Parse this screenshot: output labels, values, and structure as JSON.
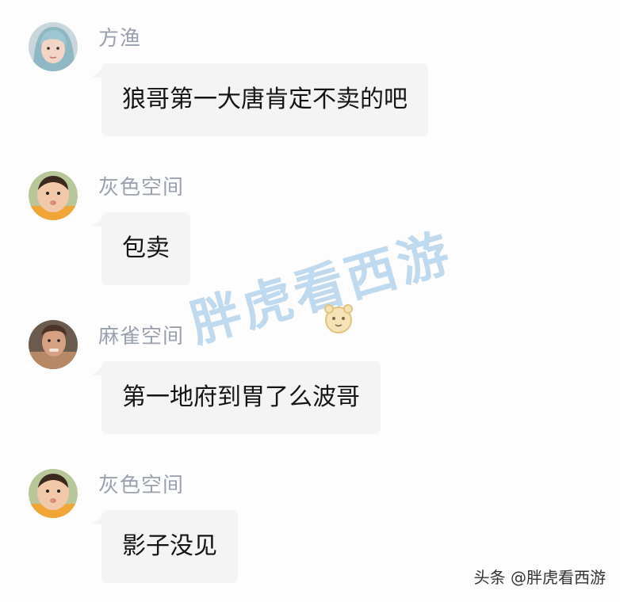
{
  "messages": [
    {
      "author": "方渔",
      "text": "狼哥第一大唐肯定不卖的吧",
      "avatar": "girl-avatar"
    },
    {
      "author": "灰色空间",
      "text": "包卖",
      "avatar": "baby-avatar"
    },
    {
      "author": "麻雀空间",
      "text": "第一地府到胃了么波哥",
      "avatar": "man-avatar"
    },
    {
      "author": "灰色空间",
      "text": "影子没见",
      "avatar": "baby-avatar"
    }
  ],
  "watermark": {
    "text": "胖虎看西游",
    "color": "#8cbee1"
  },
  "footer": {
    "text": "头条 @胖虎看西游"
  },
  "colors": {
    "bubble": "#f4f4f5",
    "name": "#9aa0ad",
    "text": "#141414"
  }
}
